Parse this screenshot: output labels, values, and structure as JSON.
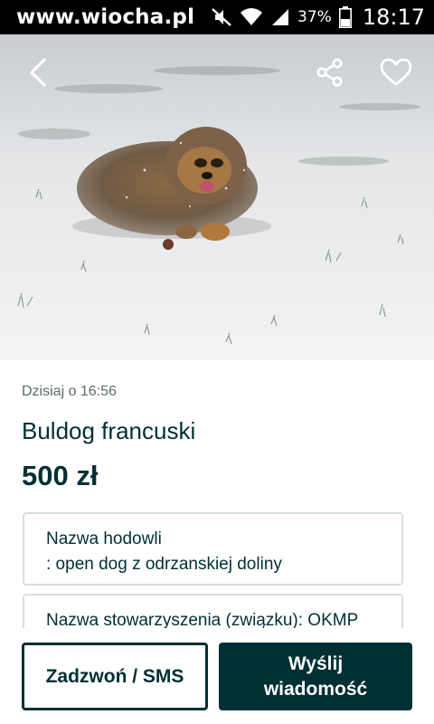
{
  "status_bar": {
    "watermark": "www.wiocha.pl",
    "battery": "37%",
    "time": "18:17"
  },
  "listing": {
    "date": "Dzisiaj o 16:56",
    "title": "Buldog francuski",
    "price": "500 zł",
    "param_1_line_1": "Nazwa hodowli",
    "param_1_line_2": ": open dog z odrzanskiej doliny",
    "param_2_line_1": "Nazwa stowarzyszenia (związku): OKMP"
  },
  "actions": {
    "call_label": "Zadzwoń / SMS",
    "message_label_1": "Wyślij",
    "message_label_2": "wiadomość"
  },
  "icons": {
    "back": "chevron-left-icon",
    "share": "share-icon",
    "favorite": "heart-outline-icon",
    "mute": "mute-icon",
    "wifi": "wifi-icon",
    "signal": "signal-icon",
    "battery": "battery-icon"
  },
  "colors": {
    "brand_dark": "#002f34",
    "text_muted": "#5b6b6e",
    "border": "#d8dfe0"
  }
}
